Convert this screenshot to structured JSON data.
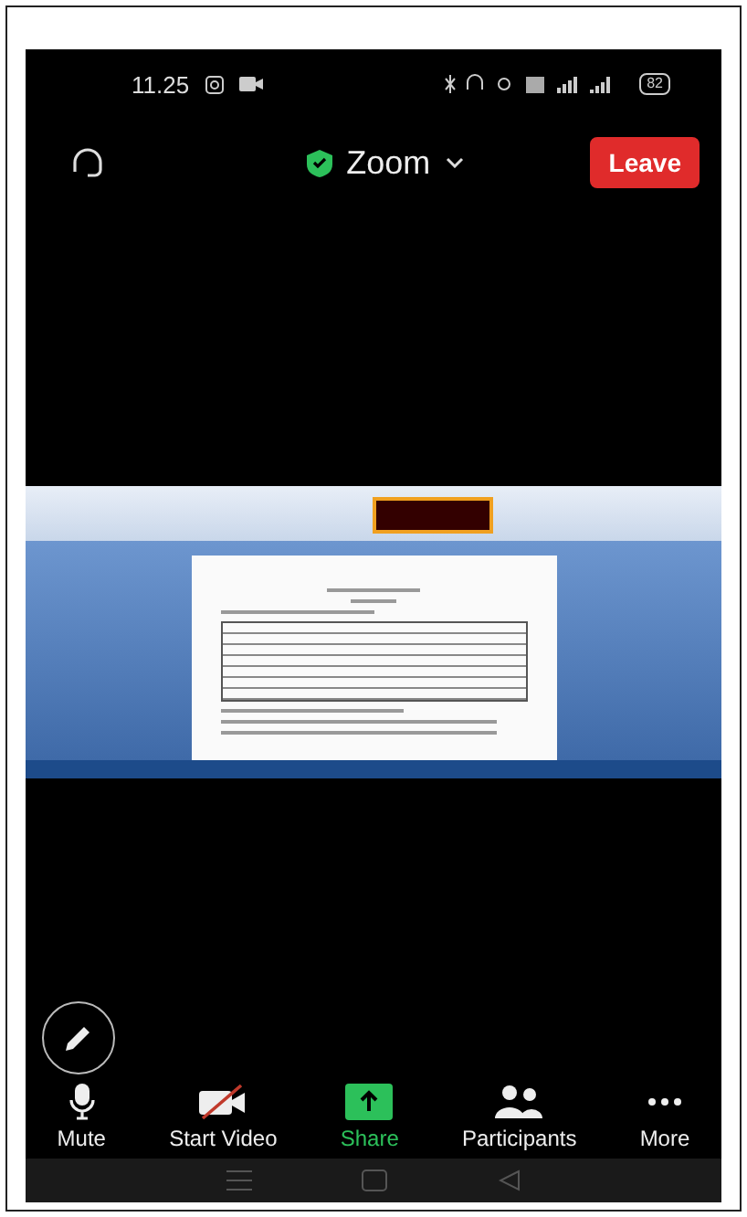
{
  "status_bar": {
    "time": "11.25",
    "battery": "82"
  },
  "meeting_bar": {
    "title": "Zoom",
    "secure": true,
    "leave_label": "Leave"
  },
  "toolbar": [
    {
      "kind": "mic",
      "label": "Mute",
      "highlighted": false
    },
    {
      "kind": "video-off",
      "label": "Start Video",
      "highlighted": false
    },
    {
      "kind": "share",
      "label": "Share",
      "highlighted": true
    },
    {
      "kind": "participants",
      "label": "Participants",
      "highlighted": false
    },
    {
      "kind": "more",
      "label": "More",
      "highlighted": false
    }
  ]
}
